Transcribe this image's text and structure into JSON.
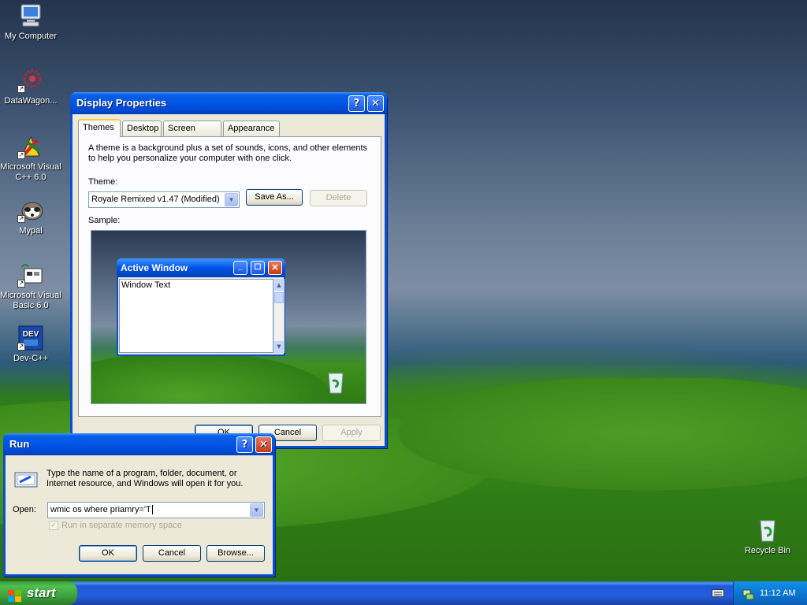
{
  "desktop": {
    "icons": [
      {
        "label": "My Computer",
        "shortcut": false
      },
      {
        "label": "DataWagon...",
        "shortcut": true
      },
      {
        "label": "Microsoft Visual C++ 6.0",
        "shortcut": true
      },
      {
        "label": "Mypal",
        "shortcut": true
      },
      {
        "label": "Microsoft Visual Basic 6.0",
        "shortcut": true
      },
      {
        "label": "Dev-C++",
        "shortcut": true
      }
    ],
    "recycle_bin": {
      "label": "Recycle Bin"
    }
  },
  "display_properties": {
    "title": "Display Properties",
    "help_glyph": "?",
    "close_glyph": "✕",
    "tabs": [
      "Themes",
      "Desktop",
      "Screen Saver",
      "Appearance"
    ],
    "active_tab": "Themes",
    "description": "A theme is a background plus a set of sounds, icons, and other elements to help you personalize your computer with one click.",
    "theme_label": "Theme:",
    "theme_value": "Royale Remixed v1.47 (Modified)",
    "save_as_label": "Save As...",
    "delete_label": "Delete",
    "sample_label": "Sample:",
    "sample_window": {
      "title": "Active Window",
      "text": "Window Text"
    },
    "ok_label": "OK",
    "cancel_label": "Cancel",
    "apply_label": "Apply"
  },
  "run_dialog": {
    "title": "Run",
    "help_glyph": "?",
    "close_glyph": "✕",
    "description": "Type the name of a program, folder, document, or Internet resource, and Windows will open it for you.",
    "open_label": "Open:",
    "open_value": "wmic os where priamry='T",
    "separate_memory_label": "Run in separate memory space",
    "separate_memory_checked": true,
    "ok_label": "OK",
    "cancel_label": "Cancel",
    "browse_label": "Browse..."
  },
  "taskbar": {
    "start_label": "start",
    "clock": "11:12 AM"
  },
  "colors": {
    "title_blue": "#0055e5",
    "close_red": "#c33c12",
    "start_green": "#3a9a3a",
    "tray_blue": "#0b77d1",
    "tab_highlight": "#ffc83c"
  }
}
